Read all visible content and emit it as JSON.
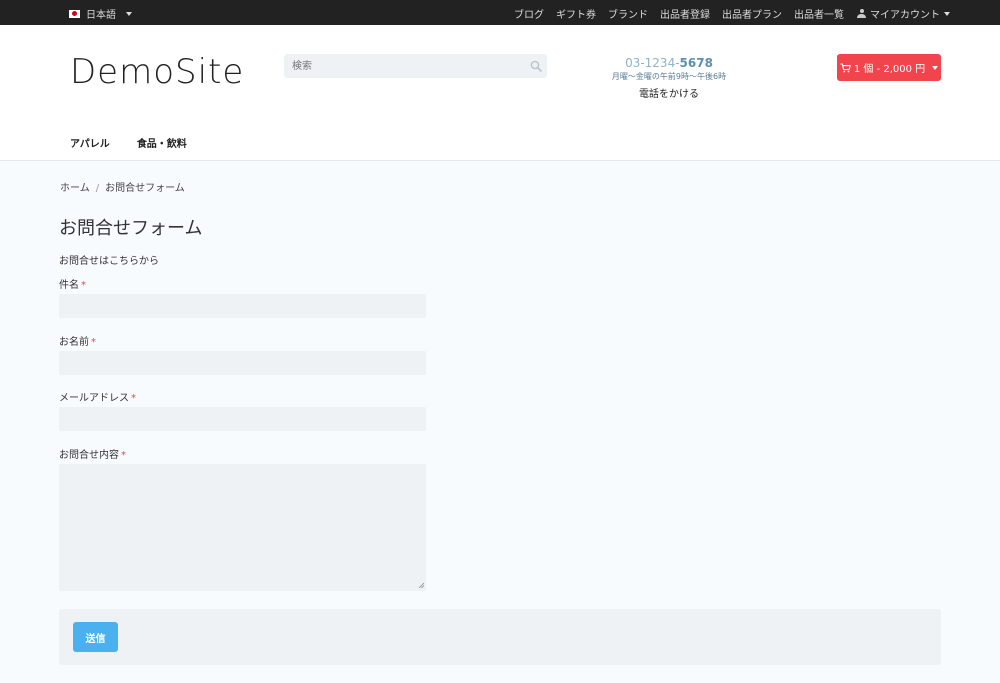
{
  "topbar": {
    "language": "日本語",
    "nav": [
      "ブログ",
      "ギフト券",
      "ブランド",
      "出品者登録",
      "出品者プラン",
      "出品者一覧"
    ],
    "account": "マイアカウント"
  },
  "header": {
    "logo": "DemoSite",
    "search_placeholder": "検索",
    "phone_prefix": "03-1234-",
    "phone_suffix": "5678",
    "hours": "月曜〜金曜の午前9時〜午後6時",
    "call_label": "電話をかける",
    "cart_label": "1 個 - 2,000 円"
  },
  "categories": [
    "アパレル",
    "食品・飲料"
  ],
  "breadcrumb": {
    "home": "ホーム",
    "current": "お問合せフォーム"
  },
  "form": {
    "title": "お問合せフォーム",
    "intro": "お問合せはこちらから",
    "fields": [
      {
        "label": "件名",
        "required": "*",
        "value": ""
      },
      {
        "label": "お名前",
        "required": "*",
        "value": ""
      },
      {
        "label": "メールアドレス",
        "required": "*",
        "value": ""
      },
      {
        "label": "お問合せ内容",
        "required": "*",
        "value": ""
      }
    ],
    "submit_label": "送信"
  },
  "colors": {
    "accent": "#4ab1ee",
    "cart": "#f1444c",
    "required": "#e24b4b"
  }
}
